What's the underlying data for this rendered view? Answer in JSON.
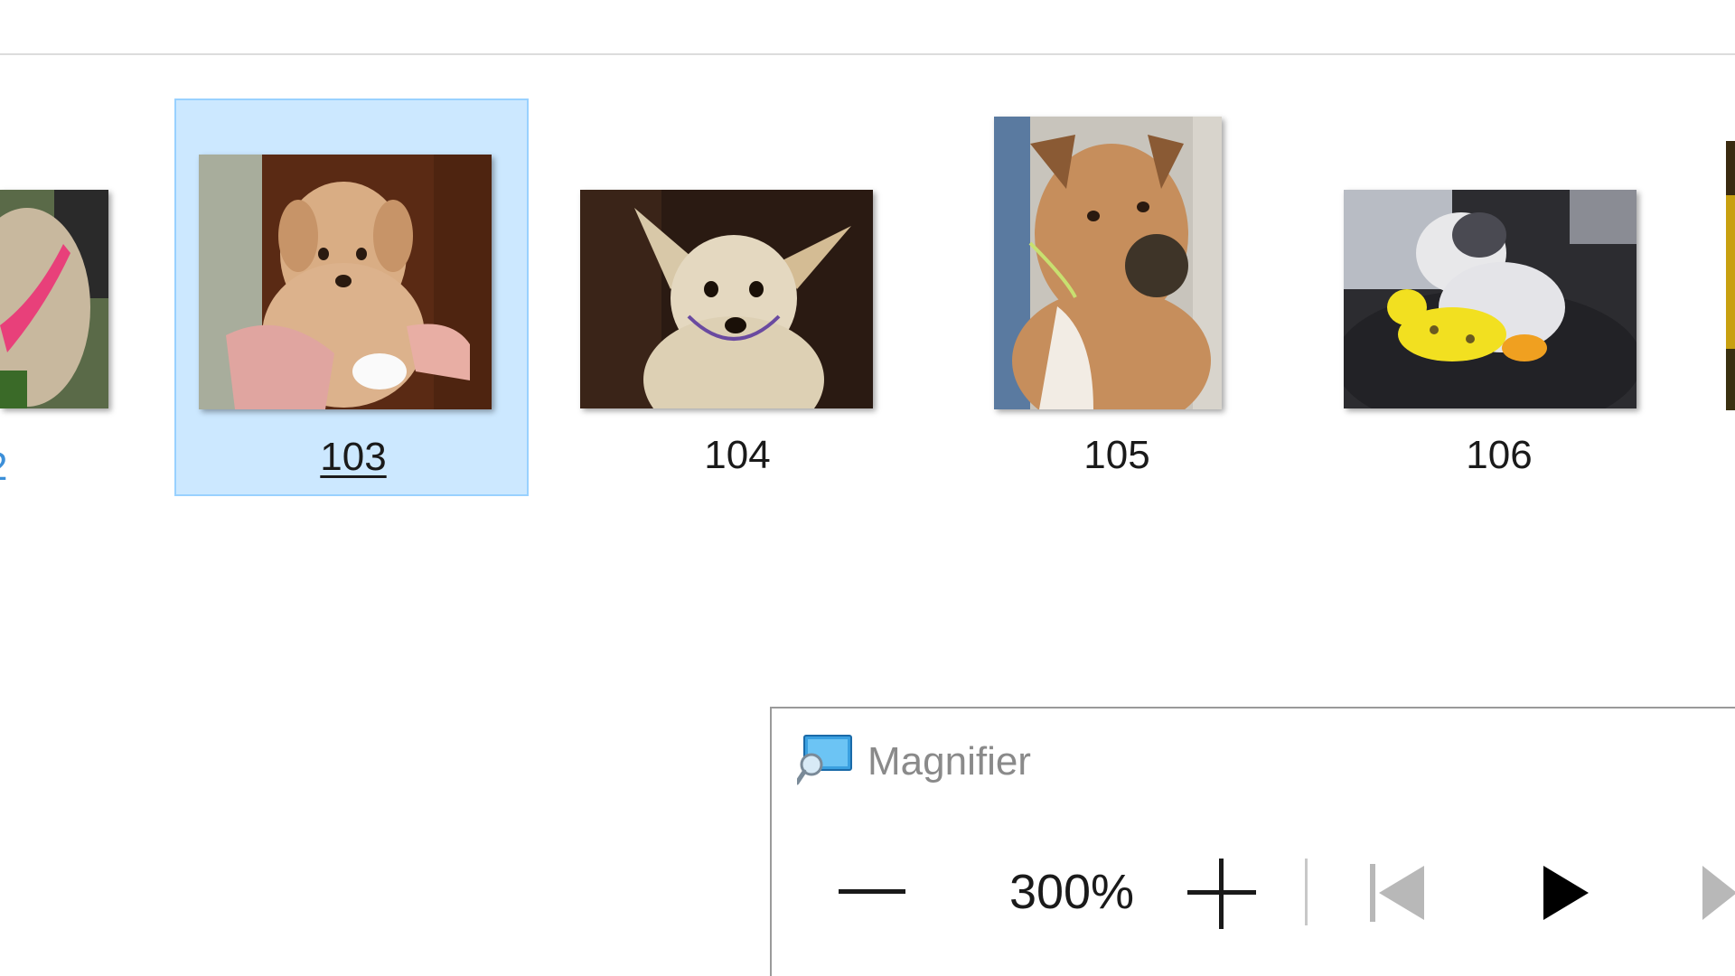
{
  "files": {
    "partial_label": "2",
    "items": [
      {
        "label": "103",
        "selected": true,
        "image": "puppy-held-in-hands"
      },
      {
        "label": "104",
        "selected": false,
        "image": "small-white-dog"
      },
      {
        "label": "105",
        "selected": false,
        "image": "tan-boxer-dog"
      },
      {
        "label": "106",
        "selected": false,
        "image": "dog-with-yellow-toy"
      }
    ]
  },
  "magnifier": {
    "title": "Magnifier",
    "zoom_level": "300%",
    "icons": {
      "app": "magnifier-app-icon",
      "zoom_out": "minus-icon",
      "zoom_in": "plus-icon",
      "previous": "skip-previous-icon",
      "play": "play-icon",
      "next": "skip-next-icon"
    }
  },
  "colors": {
    "selection_fill": "#cce8ff",
    "selection_border": "#99d1ff",
    "accent_blue": "#3c8fd8"
  }
}
